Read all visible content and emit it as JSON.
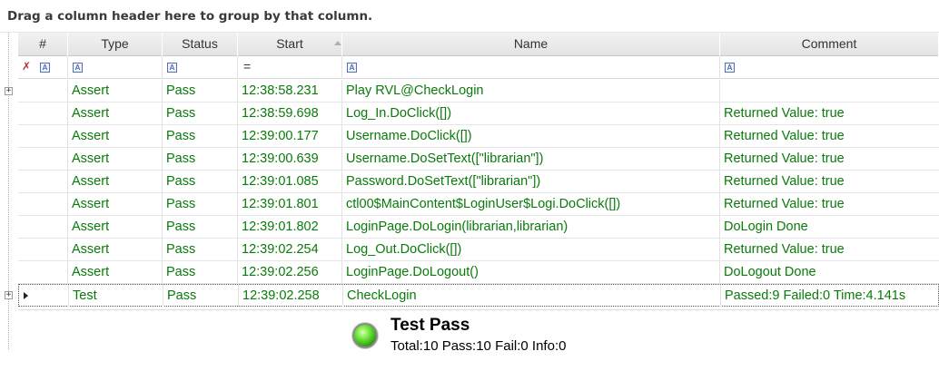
{
  "group_panel": {
    "text": "Drag a column header here to group by that column."
  },
  "columns": [
    {
      "key": "num",
      "label": "#"
    },
    {
      "key": "type",
      "label": "Type"
    },
    {
      "key": "status",
      "label": "Status"
    },
    {
      "key": "start",
      "label": "Start"
    },
    {
      "key": "name",
      "label": "Name"
    },
    {
      "key": "comment",
      "label": "Comment"
    }
  ],
  "filter_row": {
    "icon": "filter-like-icon",
    "start_operator": "="
  },
  "rows": [
    {
      "num": "",
      "type": "Assert",
      "status": "Pass",
      "start": "12:38:58.231",
      "name": "Play RVL@CheckLogin",
      "comment": ""
    },
    {
      "num": "",
      "type": "Assert",
      "status": "Pass",
      "start": "12:38:59.698",
      "name": "Log_In.DoClick([])",
      "comment": "Returned Value: true"
    },
    {
      "num": "",
      "type": "Assert",
      "status": "Pass",
      "start": "12:39:00.177",
      "name": "Username.DoClick([])",
      "comment": "Returned Value: true"
    },
    {
      "num": "",
      "type": "Assert",
      "status": "Pass",
      "start": "12:39:00.639",
      "name": "Username.DoSetText([\"librarian\"])",
      "comment": "Returned Value: true"
    },
    {
      "num": "",
      "type": "Assert",
      "status": "Pass",
      "start": "12:39:01.085",
      "name": "Password.DoSetText([\"librarian\"])",
      "comment": "Returned Value: true"
    },
    {
      "num": "",
      "type": "Assert",
      "status": "Pass",
      "start": "12:39:01.801",
      "name": "ctl00$MainContent$LoginUser$Logi.DoClick([])",
      "comment": "Returned Value: true"
    },
    {
      "num": "",
      "type": "Assert",
      "status": "Pass",
      "start": "12:39:01.802",
      "name": "LoginPage.DoLogin(librarian,librarian)",
      "comment": "DoLogin Done"
    },
    {
      "num": "",
      "type": "Assert",
      "status": "Pass",
      "start": "12:39:02.254",
      "name": "Log_Out.DoClick([])",
      "comment": "Returned Value: true"
    },
    {
      "num": "",
      "type": "Assert",
      "status": "Pass",
      "start": "12:39:02.256",
      "name": "LoginPage.DoLogout()",
      "comment": "DoLogout Done"
    },
    {
      "num": "",
      "type": "Test",
      "status": "Pass",
      "start": "12:39:02.258",
      "name": "CheckLogin",
      "comment": "Passed:9 Failed:0 Time:4.141s"
    }
  ],
  "summary": {
    "title": "Test Pass",
    "details": "Total:10 Pass:10 Fail:0 Info:0",
    "status_color": "#3cc81e"
  },
  "colors": {
    "row_text": "#0a7a0a",
    "header_bg": "#e8e8e8"
  }
}
